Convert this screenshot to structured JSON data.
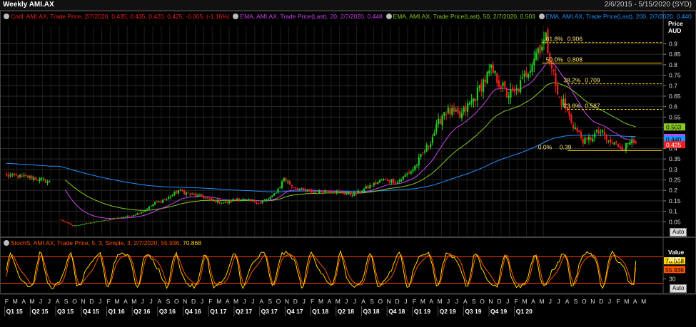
{
  "window": {
    "title": "Weekly AMI.AX",
    "date_range": "2/6/2015 - 5/15/2020 (SYD)"
  },
  "legend": {
    "candle": "Cndl, AMI.AX, Trade Price, 2/7/2020, 0.435, 0.435, 0.420, 0.425, -0.005, (-1.16%)",
    "ema20": "EMA, AMI.AX, Trade Price(Last), 20, 2/7/2020, 0.448",
    "ema50": "EMA, AMI.AX, Trade Price(Last), 50, 2/7/2020, 0.503",
    "ema200": "EMA, AMI.AX, Trade Price(Last), 200, 2/7/2020, 0.440",
    "stoch_prefix": "StochS, AMI.AX, Trade Price, 5, 3, Simple, 3, 2/7/2020, 55.936,",
    "stoch_k": "70.868"
  },
  "price_axis": {
    "title": "Price",
    "unit": "AUD",
    "auto": "Auto"
  },
  "stoch_axis": {
    "title": "Value",
    "unit": "AUD",
    "auto": "Auto"
  },
  "colors": {
    "up": "#22cc22",
    "down": "#ee2020",
    "ema20": "#cc44ee",
    "ema50": "#88cc22",
    "ema200": "#1e90ff",
    "stoch_k": "#ffd700",
    "stoch_d": "#ff5500",
    "fib": "#ffd700",
    "band": "#ff4000"
  },
  "chart_data": [
    {
      "type": "candlestick",
      "title": "Weekly AMI.AX",
      "ylabel": "Price AUD",
      "ylim": [
        0,
        0.98
      ],
      "yticks": [
        0.05,
        0.1,
        0.15,
        0.2,
        0.25,
        0.3,
        0.35,
        0.4,
        0.45,
        0.5,
        0.55,
        0.6,
        0.65,
        0.7,
        0.75,
        0.8,
        0.85,
        0.9
      ],
      "x_range": [
        "2015-02-06",
        "2020-05-15"
      ],
      "x_month_labels": [
        "F",
        "M",
        "A",
        "M",
        "J",
        "J",
        "A",
        "S",
        "O",
        "N",
        "D",
        "J",
        "F",
        "M",
        "A",
        "M",
        "J",
        "J",
        "A",
        "S",
        "O",
        "N",
        "D",
        "J",
        "F",
        "M",
        "A",
        "M",
        "J",
        "J",
        "A",
        "S",
        "O",
        "N",
        "D",
        "J",
        "F",
        "M",
        "A",
        "M",
        "J",
        "J",
        "A",
        "S",
        "O",
        "N",
        "D",
        "J",
        "F",
        "M",
        "A",
        "M",
        "J",
        "J",
        "A",
        "S",
        "O",
        "N",
        "D",
        "J",
        "F",
        "M",
        "A",
        "M",
        "J",
        "J",
        "A",
        "S",
        "O",
        "N",
        "D",
        "J",
        "F",
        "M",
        "A",
        "M"
      ],
      "x_quarter_labels": [
        "Q1 15",
        "Q2 15",
        "Q3 15",
        "Q4 15",
        "Q1 16",
        "Q2 16",
        "Q3 16",
        "Q4 16",
        "Q1 17",
        "Q2 17",
        "Q3 17",
        "Q4 17",
        "Q1 18",
        "Q2 18",
        "Q3 18",
        "Q4 18",
        "Q1 19",
        "Q2 19",
        "Q3 19",
        "Q4 19",
        "Q1 20"
      ],
      "close_path": [
        [
          0,
          0.27
        ],
        [
          14,
          0.26
        ],
        [
          22,
          0.24
        ],
        [
          28,
          0.06
        ],
        [
          34,
          0.03
        ],
        [
          40,
          0.04
        ],
        [
          46,
          0.05
        ],
        [
          52,
          0.06
        ],
        [
          58,
          0.07
        ],
        [
          64,
          0.08
        ],
        [
          70,
          0.1
        ],
        [
          76,
          0.14
        ],
        [
          82,
          0.16
        ],
        [
          88,
          0.2
        ],
        [
          94,
          0.18
        ],
        [
          100,
          0.17
        ],
        [
          106,
          0.15
        ],
        [
          112,
          0.14
        ],
        [
          118,
          0.16
        ],
        [
          124,
          0.15
        ],
        [
          130,
          0.14
        ],
        [
          136,
          0.17
        ],
        [
          140,
          0.22
        ],
        [
          142,
          0.26
        ],
        [
          146,
          0.22
        ],
        [
          152,
          0.2
        ],
        [
          158,
          0.19
        ],
        [
          164,
          0.2
        ],
        [
          170,
          0.19
        ],
        [
          176,
          0.18
        ],
        [
          180,
          0.19
        ],
        [
          186,
          0.22
        ],
        [
          192,
          0.25
        ],
        [
          196,
          0.25
        ],
        [
          200,
          0.24
        ],
        [
          204,
          0.27
        ],
        [
          208,
          0.3
        ],
        [
          212,
          0.36
        ],
        [
          216,
          0.42
        ],
        [
          220,
          0.5
        ],
        [
          224,
          0.58
        ],
        [
          228,
          0.57
        ],
        [
          232,
          0.55
        ],
        [
          236,
          0.6
        ],
        [
          240,
          0.65
        ],
        [
          244,
          0.72
        ],
        [
          248,
          0.77
        ],
        [
          252,
          0.72
        ],
        [
          256,
          0.66
        ],
        [
          260,
          0.66
        ],
        [
          264,
          0.72
        ],
        [
          268,
          0.8
        ],
        [
          272,
          0.88
        ],
        [
          276,
          0.92
        ],
        [
          279,
          0.8
        ],
        [
          282,
          0.65
        ],
        [
          285,
          0.62
        ],
        [
          288,
          0.55
        ],
        [
          292,
          0.48
        ],
        [
          296,
          0.43
        ],
        [
          300,
          0.46
        ],
        [
          304,
          0.48
        ],
        [
          308,
          0.43
        ],
        [
          312,
          0.42
        ],
        [
          316,
          0.4
        ],
        [
          319,
          0.44
        ],
        [
          320,
          0.46
        ],
        [
          322,
          0.425
        ]
      ],
      "ema20_last": 0.448,
      "ema50_last": 0.503,
      "ema200_last": 0.44,
      "last_candle": {
        "date": "2/7/2020",
        "open": 0.435,
        "high": 0.435,
        "low": 0.42,
        "close": 0.425,
        "change": -0.005,
        "change_pct": "-1.16%"
      },
      "fibonacci": [
        {
          "label": "61.8%",
          "value": 0.906
        },
        {
          "label": "50.0%",
          "value": 0.808
        },
        {
          "label": "38.2%",
          "value": 0.709
        },
        {
          "label": "23.6%",
          "value": 0.587
        },
        {
          "label": "0.0%",
          "value": 0.39
        }
      ],
      "last_value_tags": [
        {
          "value": "0.503",
          "series": "EMA 50"
        },
        {
          "value": "0.448",
          "series": "EMA 20"
        },
        {
          "value": "0.440",
          "series": "EMA 200"
        },
        {
          "value": "0.425",
          "series": "Close"
        }
      ]
    },
    {
      "type": "line",
      "title": "StochS, AMI.AX, Trade Price, 5, 3, Simple, 3",
      "ylabel": "Value AUD",
      "ylim": [
        0,
        100
      ],
      "yticks": [
        30
      ],
      "bands": [
        20,
        80
      ],
      "series": [
        {
          "name": "%K",
          "last": 70.868
        },
        {
          "name": "%D",
          "last": 55.936
        }
      ],
      "cycle_weeks": 14
    }
  ]
}
